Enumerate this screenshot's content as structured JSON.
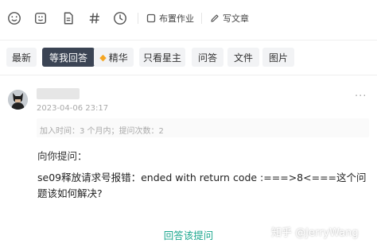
{
  "toolbar": {
    "icons": [
      "emoji-icon",
      "image-icon",
      "file-icon",
      "hashtag-icon",
      "clock-icon"
    ],
    "assign_label": "布置作业",
    "write_label": "写文章"
  },
  "filters": [
    {
      "label": "最新",
      "active": false
    },
    {
      "label": "等我回答",
      "active": true
    },
    {
      "label": "精华",
      "active": false,
      "icon": "gem-icon"
    },
    {
      "label": "只看星主",
      "active": false
    },
    {
      "label": "问答",
      "active": false
    },
    {
      "label": "文件",
      "active": false
    },
    {
      "label": "图片",
      "active": false
    }
  ],
  "post": {
    "time": "2023-04-06 23:17",
    "meta": "加入时间：3 个月内；提问次数：2",
    "question_label": "向你提问：",
    "question_text": "se09释放请求号报错：ended with return code :===>8<===这个问题该如何解决?",
    "more": "···"
  },
  "answer_label": "回答该提问",
  "watermark": "知乎 @JerryWang"
}
